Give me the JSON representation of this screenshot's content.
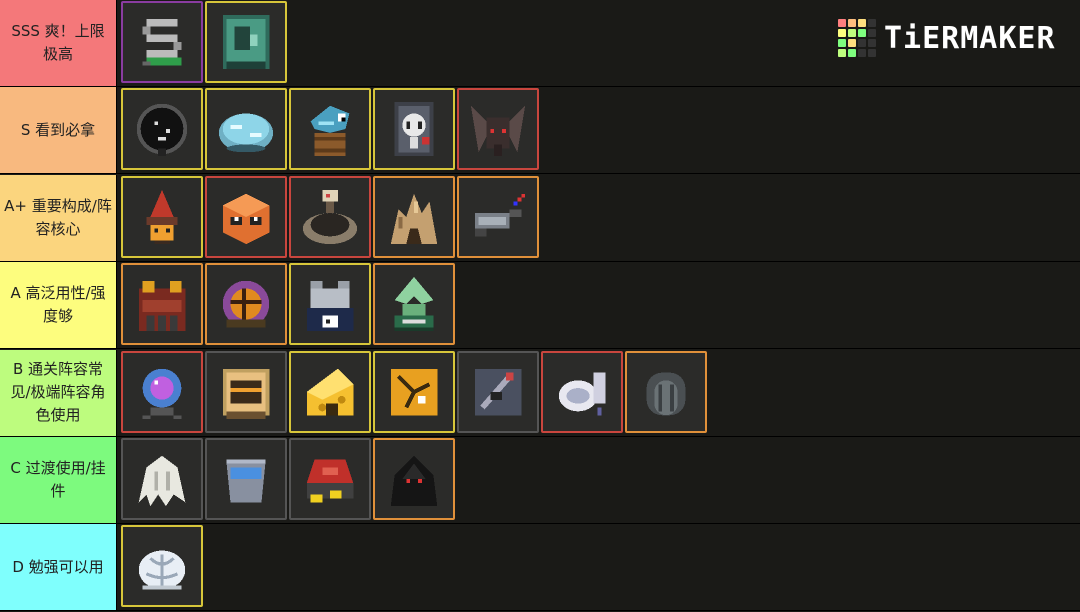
{
  "logo": {
    "text": "TiERMAKER",
    "grid_colors": [
      "#ff7f7f",
      "#ffbf7f",
      "#ffdf7f",
      "#333333",
      "#ffff7f",
      "#bfff7f",
      "#7fff7f",
      "#333333",
      "#7fff7f",
      "#ffdf7f",
      "#333333",
      "#333333",
      "#bfff7f",
      "#7fff7f",
      "#333333",
      "#333333"
    ]
  },
  "tiers": [
    {
      "label": "SSS 爽！上限极高",
      "color": "#f4787a",
      "items": [
        {
          "icon": "gray-coil-icon",
          "border": "#8a3ca0"
        },
        {
          "icon": "green-cabinet-icon",
          "border": "#d7c63a"
        }
      ]
    },
    {
      "label": "S 看到必拿",
      "color": "#f8b97f",
      "items": [
        {
          "icon": "black-orb-icon",
          "border": "#d7c63a"
        },
        {
          "icon": "water-bowl-icon",
          "border": "#d7c63a"
        },
        {
          "icon": "fish-barrel-icon",
          "border": "#d7c63a"
        },
        {
          "icon": "skull-device-icon",
          "border": "#d7c63a"
        },
        {
          "icon": "horned-helmet-icon",
          "border": "#c9463e"
        }
      ]
    },
    {
      "label": "A+ 重要构成/阵容核心",
      "color": "#fbd57e",
      "items": [
        {
          "icon": "wizard-hat-icon",
          "border": "#d7c63a"
        },
        {
          "icon": "orange-box-icon",
          "border": "#c9463e"
        },
        {
          "icon": "stone-well-icon",
          "border": "#c9463e"
        },
        {
          "icon": "rock-cave-icon",
          "border": "#e0903a"
        },
        {
          "icon": "syringe-gun-icon",
          "border": "#e0903a"
        }
      ]
    },
    {
      "label": "A 高泛用性/强度够",
      "color": "#fdfd7e",
      "items": [
        {
          "icon": "red-backpack-icon",
          "border": "#e0903a"
        },
        {
          "icon": "basketball-bag-icon",
          "border": "#e0903a"
        },
        {
          "icon": "stone-pedestal-icon",
          "border": "#d7c63a"
        },
        {
          "icon": "slime-fountain-icon",
          "border": "#e0903a"
        }
      ]
    },
    {
      "label": "B 通关阵容常见/极端阵容角色使用",
      "color": "#bdfc7e",
      "items": [
        {
          "icon": "crystal-ball-icon",
          "border": "#c9463e"
        },
        {
          "icon": "framed-jar-icon",
          "border": "#555555"
        },
        {
          "icon": "cheese-icon",
          "border": "#d7c63a"
        },
        {
          "icon": "cracked-tile-icon",
          "border": "#d7c63a"
        },
        {
          "icon": "rat-frame-icon",
          "border": "#555555"
        },
        {
          "icon": "toilet-icon",
          "border": "#c9463e"
        },
        {
          "icon": "tire-icon",
          "border": "#e0903a"
        }
      ]
    },
    {
      "label": "C 过渡使用/挂件",
      "color": "#7dfa7e",
      "items": [
        {
          "icon": "white-hair-icon",
          "border": "#555555"
        },
        {
          "icon": "blue-bucket-icon",
          "border": "#555555"
        },
        {
          "icon": "treasure-pile-icon",
          "border": "#555555"
        },
        {
          "icon": "black-cloak-icon",
          "border": "#e0903a"
        }
      ]
    },
    {
      "label": "D 勉强可以用",
      "color": "#7ffffd",
      "items": [
        {
          "icon": "white-brain-icon",
          "border": "#d7c63a"
        }
      ]
    }
  ]
}
